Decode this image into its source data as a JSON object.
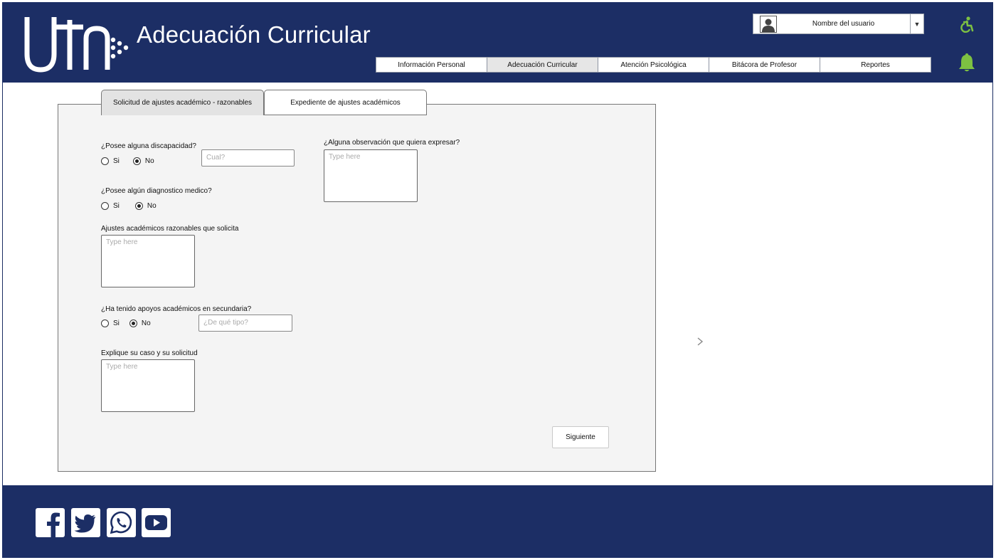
{
  "header": {
    "title": "Adecuación Curricular",
    "logo_text": "uTn",
    "user": {
      "name": "Nombre del usuario"
    },
    "nav": [
      {
        "label": "Información Personal",
        "active": false
      },
      {
        "label": "Adecuación Curricular",
        "active": true
      },
      {
        "label": "Atención Psicológica",
        "active": false
      },
      {
        "label": "Bitácora de Profesor",
        "active": false
      },
      {
        "label": "Reportes",
        "active": false
      }
    ]
  },
  "tabs": [
    {
      "label": "Solicitud de ajustes académico - razonables",
      "active": true
    },
    {
      "label": "Expediente de ajustes académicos",
      "active": false
    }
  ],
  "form": {
    "q_discapacidad": "¿Posee alguna discapacidad?",
    "q_diagnostico": "¿Posee algún diagnostico medico?",
    "q_ajustes": "Ajustes académicos razonables que solicita",
    "q_apoyos": "¿Ha tenido apoyos académicos en secundaria?",
    "q_explique": "Explique su caso y su solicitud",
    "q_observacion": "¿Alguna observación que quiera expresar?",
    "opt_si": "Si",
    "opt_no": "No",
    "cual_placeholder": "Cual?",
    "tipo_placeholder": "¿De qué tipo?",
    "textarea_placeholder": "Type here",
    "next_label": "Siguiente"
  },
  "footer": {
    "social": [
      "facebook",
      "twitter",
      "whatsapp",
      "youtube"
    ]
  },
  "colors": {
    "brand": "#1c2e65",
    "accent_green": "#7dc142"
  }
}
